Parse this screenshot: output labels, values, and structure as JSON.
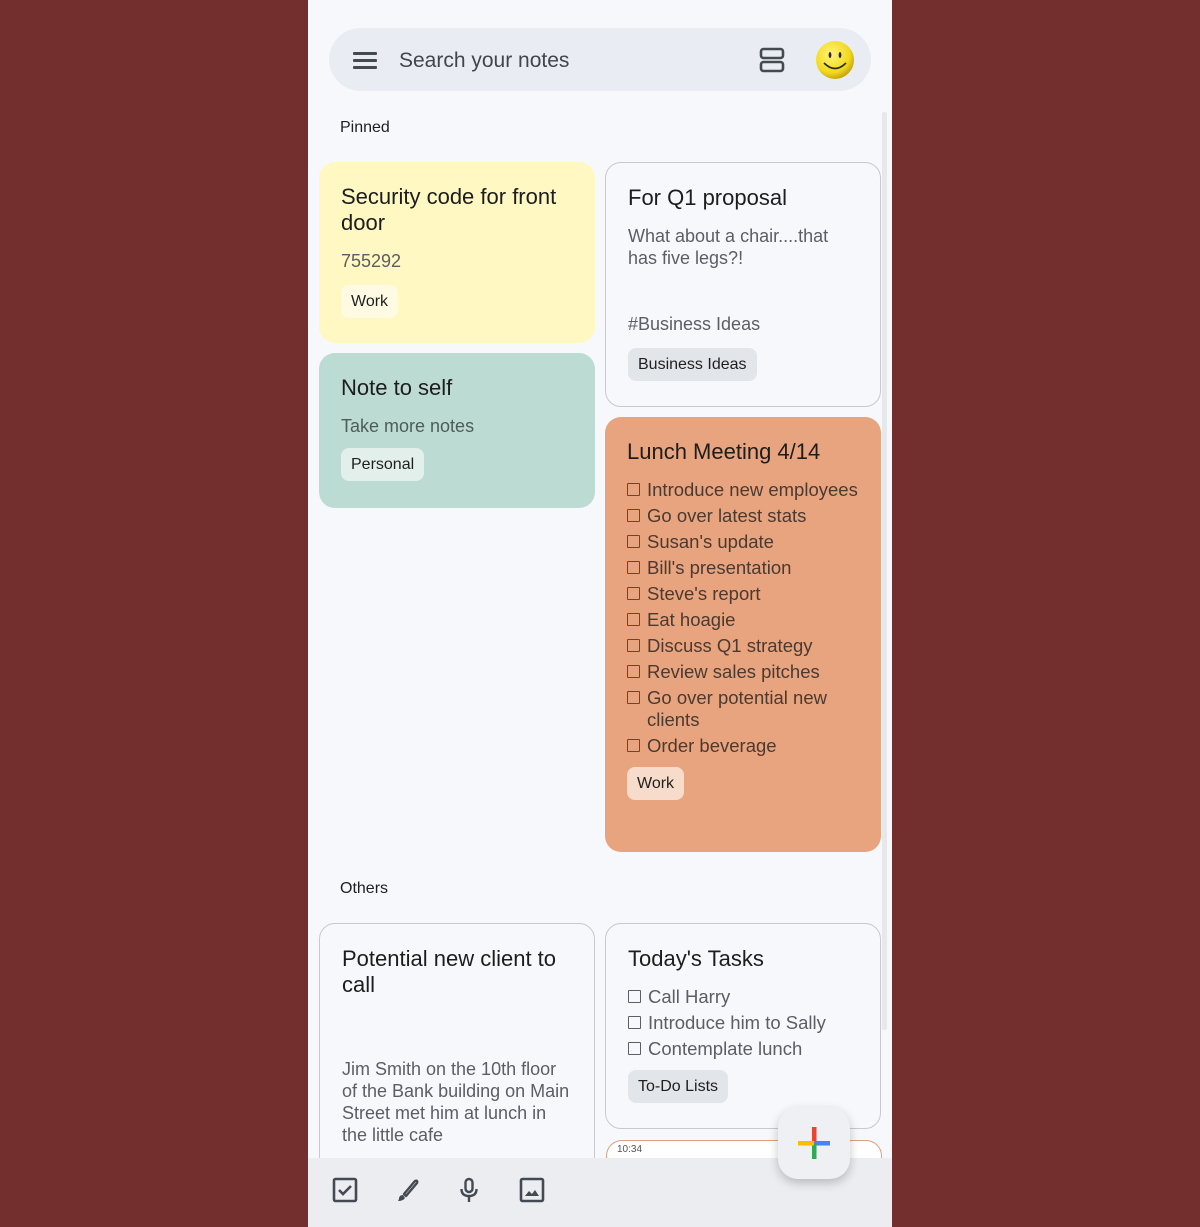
{
  "search": {
    "placeholder": "Search your notes"
  },
  "icons": {
    "menu": "menu-icon",
    "layout": "list-view-icon",
    "avatar": "smiley-avatar"
  },
  "sections": {
    "pinned": "Pinned",
    "others": "Others"
  },
  "pinned": [
    {
      "title": "Security code for front door",
      "body": "755292",
      "label": "Work",
      "color": "#fff8c2"
    },
    {
      "title": "Note to self",
      "body": "Take more notes",
      "label": "Personal",
      "color": "#bcdbd3"
    },
    {
      "title": "For Q1 proposal",
      "body": "What about a chair....that has five legs?!",
      "hashtag": "#Business Ideas",
      "label": "Business Ideas"
    },
    {
      "title": "Lunch Meeting 4/14",
      "checklist": [
        "Introduce new employees",
        "Go over latest stats",
        "Susan's update",
        "Bill's presentation",
        "Steve's report",
        "Eat hoagie",
        "Discuss Q1 strategy",
        "Review sales pitches",
        "Go over potential new clients",
        "Order beverage"
      ],
      "label": "Work",
      "color": "#e8a47e"
    }
  ],
  "others": [
    {
      "title": "Potential new client to call",
      "body": "Jim Smith on the 10th floor of the Bank building on Main Street met him at lunch in the little cafe"
    },
    {
      "title": "Today's Tasks",
      "checklist": [
        "Call Harry",
        "Introduce him to Sally",
        "Contemplate lunch"
      ],
      "label": "To-Do Lists"
    },
    {
      "peek_time": "10:34"
    }
  ],
  "bottom_bar": {
    "items": [
      "new-list",
      "new-drawing",
      "new-voice-note",
      "new-image-note"
    ]
  },
  "fab": {
    "label": "New note",
    "colors": [
      "#ea4335",
      "#4285f4",
      "#34a853",
      "#fbbc04"
    ]
  }
}
